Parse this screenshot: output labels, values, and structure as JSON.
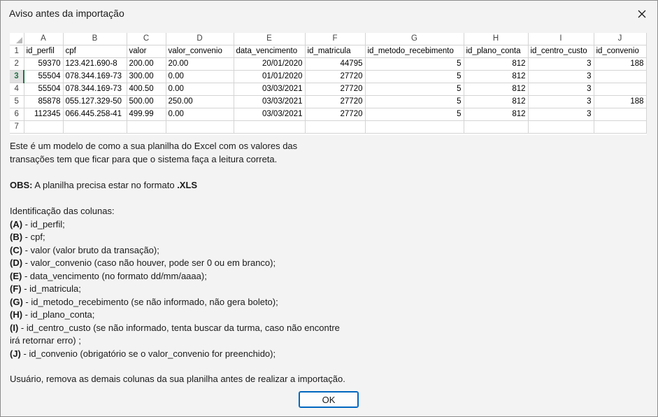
{
  "window": {
    "title": "Aviso antes da importação"
  },
  "sheet": {
    "column_letters": [
      "A",
      "B",
      "C",
      "D",
      "E",
      "F",
      "G",
      "H",
      "I",
      "J"
    ],
    "row_numbers": [
      "1",
      "2",
      "3",
      "4",
      "5",
      "6",
      "7"
    ],
    "rows": [
      [
        "id_perfil",
        "cpf",
        "valor",
        "valor_convenio",
        "data_vencimento",
        "id_matricula",
        "id_metodo_recebimento",
        "id_plano_conta",
        "id_centro_custo",
        "id_convenio"
      ],
      [
        "59370",
        "123.421.690-8",
        "200.00",
        "20.00",
        "20/01/2020",
        "44795",
        "5",
        "812",
        "3",
        "188"
      ],
      [
        "55504",
        "078.344.169-73",
        "300.00",
        "0.00",
        "01/01/2020",
        "27720",
        "5",
        "812",
        "3",
        ""
      ],
      [
        "55504",
        "078.344.169-73",
        "400.50",
        "0.00",
        "03/03/2021",
        "27720",
        "5",
        "812",
        "3",
        ""
      ],
      [
        "85878",
        "055.127.329-50",
        "500.00",
        "250.00",
        "03/03/2021",
        "27720",
        "5",
        "812",
        "3",
        "188"
      ],
      [
        "112345",
        "066.445.258-41",
        "499.99",
        "0.00",
        "03/03/2021",
        "27720",
        "5",
        "812",
        "3",
        ""
      ],
      [
        "",
        "",
        "",
        "",
        "",
        "",
        "",
        "",
        "",
        ""
      ]
    ]
  },
  "message": {
    "intro_line1": "Este é um modelo de como a sua planilha do Excel com os valores das",
    "intro_line2": "transações tem que ficar para que o sistema faça a leitura correta.",
    "obs_label": "OBS:",
    "obs_text": " A planilha precisa estar no formato ",
    "obs_format": ".XLS",
    "columns_heading": "Identificação das colunas:",
    "columns": [
      {
        "key": "(A)",
        "text": " - id_perfil;"
      },
      {
        "key": "(B)",
        "text": " - cpf;"
      },
      {
        "key": "(C)",
        "text": " - valor (valor bruto da transação);"
      },
      {
        "key": "(D)",
        "text": " - valor_convenio (caso não houver, pode ser 0 ou em branco);"
      },
      {
        "key": "(E)",
        "text": " - data_vencimento (no formato dd/mm/aaaa);"
      },
      {
        "key": "(F)",
        "text": " - id_matricula;"
      },
      {
        "key": "(G)",
        "text": " - id_metodo_recebimento (se não informado, não gera boleto);"
      },
      {
        "key": "(H)",
        "text": " - id_plano_conta;"
      },
      {
        "key": "(I)",
        "text": " - id_centro_custo (se não informado, tenta buscar da turma, caso não encontre"
      },
      {
        "key": "",
        "text": "irá retornar erro) ;"
      },
      {
        "key": "(J)",
        "text": " - id_convenio (obrigatório se o valor_convenio for preenchido);"
      }
    ],
    "footer": "Usuário, remova as demais colunas da sua planilha antes de realizar a importação."
  },
  "buttons": {
    "ok_label": "OK"
  },
  "icons": {
    "close": "close-icon"
  },
  "colors": {
    "accent": "#0067c0",
    "excel_green": "#217346"
  }
}
